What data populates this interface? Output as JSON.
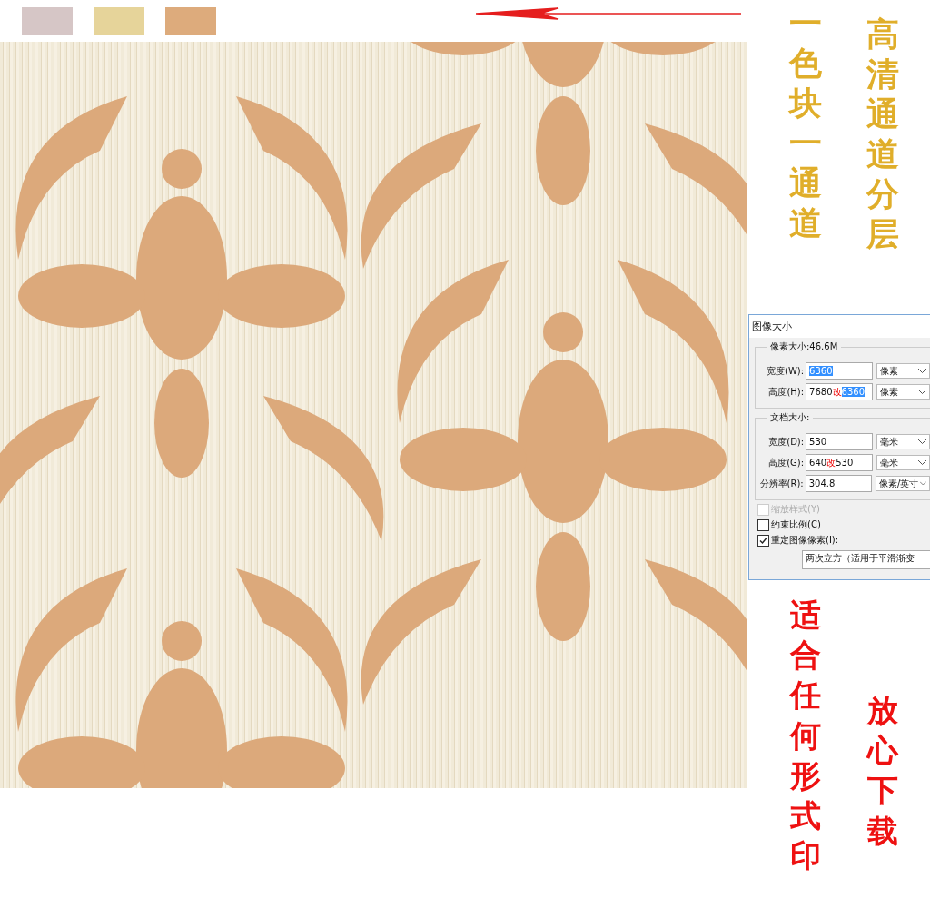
{
  "swatches": [
    {
      "color": "#d6c6c6"
    },
    {
      "color": "#e6d49a"
    },
    {
      "color": "#ddab7c"
    }
  ],
  "captions": [
    {
      "text": "一色块一通道",
      "kind": "gold"
    },
    {
      "text": "高清通道分层",
      "kind": "gold"
    },
    {
      "text": "适合任何形式印",
      "kind": "red"
    },
    {
      "text": "放心下载",
      "kind": "red"
    }
  ],
  "dialog": {
    "title": "图像大小",
    "pixel_group": {
      "legend": "像素大小:46.6M",
      "rows": [
        {
          "label": "宽度(W):",
          "value": "6360",
          "value_selected": true,
          "note": "",
          "replacement": "",
          "unit": "像素"
        },
        {
          "label": "高度(H):",
          "value": "7680",
          "value_selected": false,
          "note": "改",
          "replacement": "6360",
          "unit": "像素"
        }
      ]
    },
    "document_group": {
      "legend": "文档大小:",
      "rows": [
        {
          "label": "宽度(D):",
          "value": "530",
          "value_selected": false,
          "note": "",
          "replacement": "",
          "unit": "毫米"
        },
        {
          "label": "高度(G):",
          "value": "640",
          "value_selected": false,
          "note": "改",
          "replacement": "530",
          "unit": "毫米"
        },
        {
          "label": "分辨率(R):",
          "value": "304.8",
          "value_selected": false,
          "note": "",
          "replacement": "",
          "unit": "像素/英寸"
        }
      ]
    },
    "options": [
      {
        "label": "缩放样式(Y)",
        "checked": false,
        "disabled": true
      },
      {
        "label": "约束比例(C)",
        "checked": false,
        "disabled": false
      },
      {
        "label": "重定图像像素(I):",
        "checked": true,
        "disabled": false
      }
    ],
    "resample": "两次立方（适用于平滑渐变"
  }
}
